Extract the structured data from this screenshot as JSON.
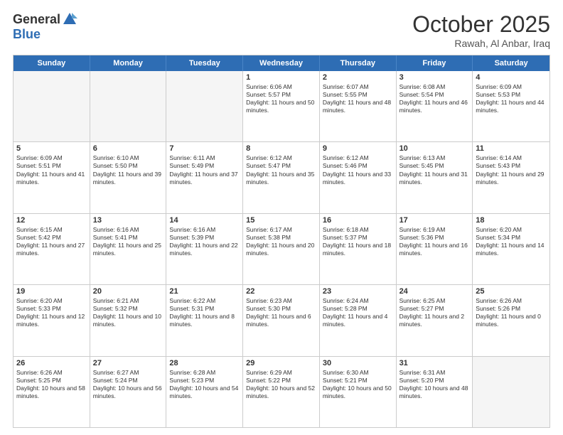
{
  "header": {
    "logo": {
      "general": "General",
      "blue": "Blue"
    },
    "title": "October 2025",
    "location": "Rawah, Al Anbar, Iraq"
  },
  "dayHeaders": [
    "Sunday",
    "Monday",
    "Tuesday",
    "Wednesday",
    "Thursday",
    "Friday",
    "Saturday"
  ],
  "weeks": [
    [
      {
        "day": "",
        "empty": true
      },
      {
        "day": "",
        "empty": true
      },
      {
        "day": "",
        "empty": true
      },
      {
        "day": "1",
        "sunrise": "6:06 AM",
        "sunset": "5:57 PM",
        "daylight": "11 hours and 50 minutes."
      },
      {
        "day": "2",
        "sunrise": "6:07 AM",
        "sunset": "5:55 PM",
        "daylight": "11 hours and 48 minutes."
      },
      {
        "day": "3",
        "sunrise": "6:08 AM",
        "sunset": "5:54 PM",
        "daylight": "11 hours and 46 minutes."
      },
      {
        "day": "4",
        "sunrise": "6:09 AM",
        "sunset": "5:53 PM",
        "daylight": "11 hours and 44 minutes."
      }
    ],
    [
      {
        "day": "5",
        "sunrise": "6:09 AM",
        "sunset": "5:51 PM",
        "daylight": "11 hours and 41 minutes."
      },
      {
        "day": "6",
        "sunrise": "6:10 AM",
        "sunset": "5:50 PM",
        "daylight": "11 hours and 39 minutes."
      },
      {
        "day": "7",
        "sunrise": "6:11 AM",
        "sunset": "5:49 PM",
        "daylight": "11 hours and 37 minutes."
      },
      {
        "day": "8",
        "sunrise": "6:12 AM",
        "sunset": "5:47 PM",
        "daylight": "11 hours and 35 minutes."
      },
      {
        "day": "9",
        "sunrise": "6:12 AM",
        "sunset": "5:46 PM",
        "daylight": "11 hours and 33 minutes."
      },
      {
        "day": "10",
        "sunrise": "6:13 AM",
        "sunset": "5:45 PM",
        "daylight": "11 hours and 31 minutes."
      },
      {
        "day": "11",
        "sunrise": "6:14 AM",
        "sunset": "5:43 PM",
        "daylight": "11 hours and 29 minutes."
      }
    ],
    [
      {
        "day": "12",
        "sunrise": "6:15 AM",
        "sunset": "5:42 PM",
        "daylight": "11 hours and 27 minutes."
      },
      {
        "day": "13",
        "sunrise": "6:16 AM",
        "sunset": "5:41 PM",
        "daylight": "11 hours and 25 minutes."
      },
      {
        "day": "14",
        "sunrise": "6:16 AM",
        "sunset": "5:39 PM",
        "daylight": "11 hours and 22 minutes."
      },
      {
        "day": "15",
        "sunrise": "6:17 AM",
        "sunset": "5:38 PM",
        "daylight": "11 hours and 20 minutes."
      },
      {
        "day": "16",
        "sunrise": "6:18 AM",
        "sunset": "5:37 PM",
        "daylight": "11 hours and 18 minutes."
      },
      {
        "day": "17",
        "sunrise": "6:19 AM",
        "sunset": "5:36 PM",
        "daylight": "11 hours and 16 minutes."
      },
      {
        "day": "18",
        "sunrise": "6:20 AM",
        "sunset": "5:34 PM",
        "daylight": "11 hours and 14 minutes."
      }
    ],
    [
      {
        "day": "19",
        "sunrise": "6:20 AM",
        "sunset": "5:33 PM",
        "daylight": "11 hours and 12 minutes."
      },
      {
        "day": "20",
        "sunrise": "6:21 AM",
        "sunset": "5:32 PM",
        "daylight": "11 hours and 10 minutes."
      },
      {
        "day": "21",
        "sunrise": "6:22 AM",
        "sunset": "5:31 PM",
        "daylight": "11 hours and 8 minutes."
      },
      {
        "day": "22",
        "sunrise": "6:23 AM",
        "sunset": "5:30 PM",
        "daylight": "11 hours and 6 minutes."
      },
      {
        "day": "23",
        "sunrise": "6:24 AM",
        "sunset": "5:28 PM",
        "daylight": "11 hours and 4 minutes."
      },
      {
        "day": "24",
        "sunrise": "6:25 AM",
        "sunset": "5:27 PM",
        "daylight": "11 hours and 2 minutes."
      },
      {
        "day": "25",
        "sunrise": "6:26 AM",
        "sunset": "5:26 PM",
        "daylight": "11 hours and 0 minutes."
      }
    ],
    [
      {
        "day": "26",
        "sunrise": "6:26 AM",
        "sunset": "5:25 PM",
        "daylight": "10 hours and 58 minutes."
      },
      {
        "day": "27",
        "sunrise": "6:27 AM",
        "sunset": "5:24 PM",
        "daylight": "10 hours and 56 minutes."
      },
      {
        "day": "28",
        "sunrise": "6:28 AM",
        "sunset": "5:23 PM",
        "daylight": "10 hours and 54 minutes."
      },
      {
        "day": "29",
        "sunrise": "6:29 AM",
        "sunset": "5:22 PM",
        "daylight": "10 hours and 52 minutes."
      },
      {
        "day": "30",
        "sunrise": "6:30 AM",
        "sunset": "5:21 PM",
        "daylight": "10 hours and 50 minutes."
      },
      {
        "day": "31",
        "sunrise": "6:31 AM",
        "sunset": "5:20 PM",
        "daylight": "10 hours and 48 minutes."
      },
      {
        "day": "",
        "empty": true
      }
    ]
  ]
}
